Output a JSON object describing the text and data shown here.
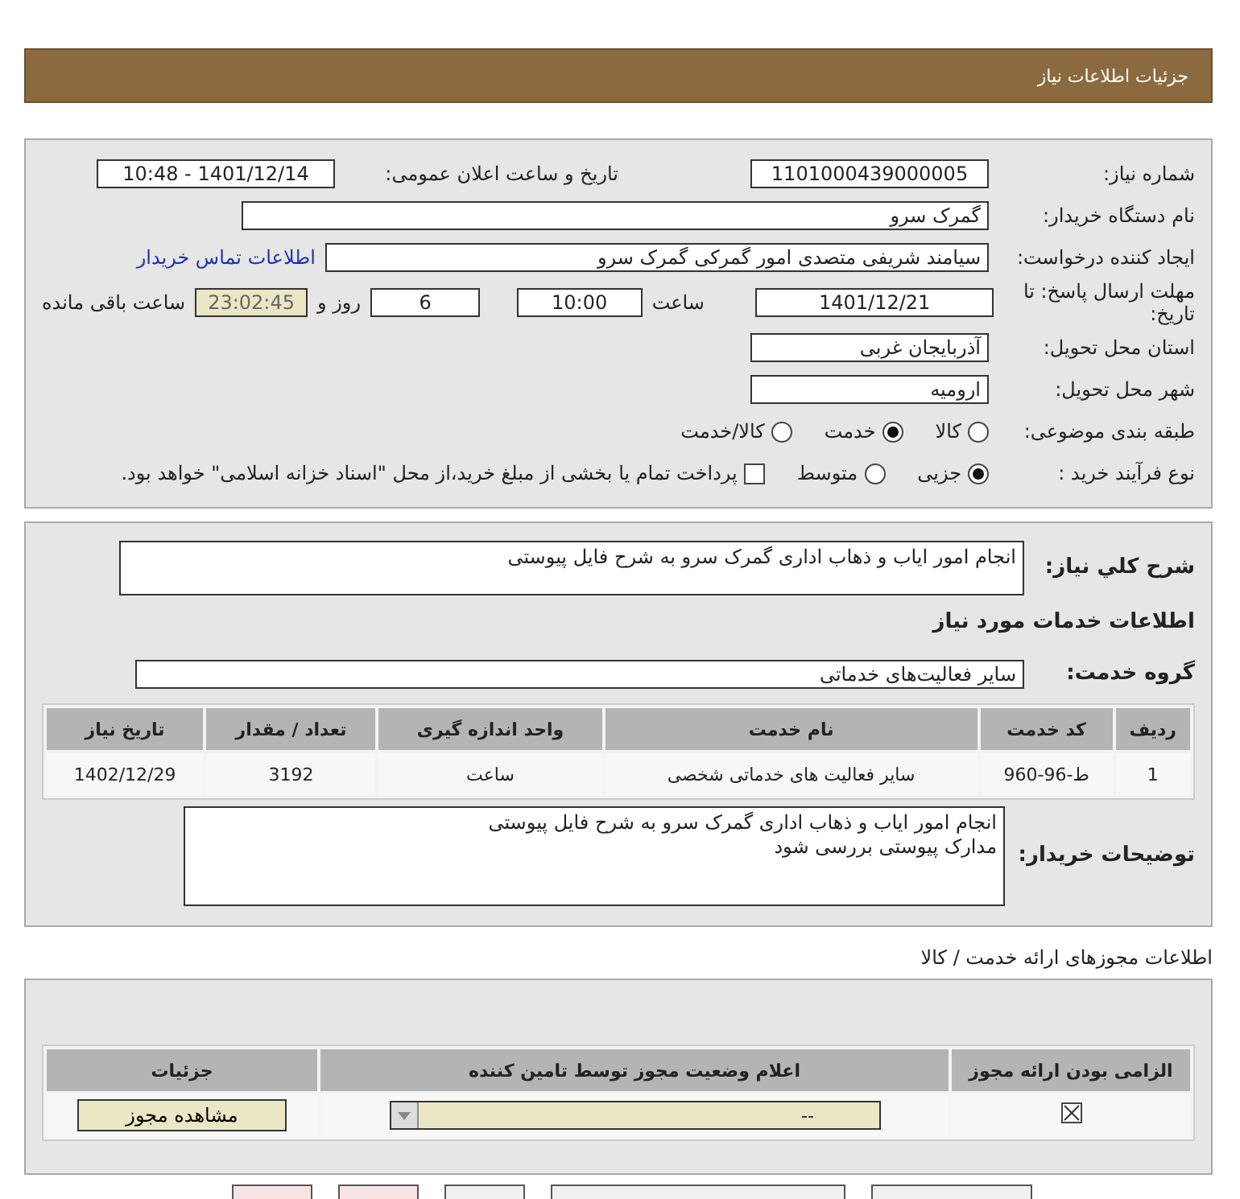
{
  "header": {
    "title": "جزئیات اطلاعات نیاز"
  },
  "details": {
    "need_number": {
      "label": "شماره نیاز:",
      "value": "1101000439000005"
    },
    "announce": {
      "label": "تاریخ و ساعت اعلان عمومی:",
      "value": "1401/12/14 - 10:48"
    },
    "buyer": {
      "label": "نام دستگاه خریدار:",
      "value": "گمرک سرو"
    },
    "creator": {
      "label": "ایجاد کننده درخواست:",
      "value": "سیامند شریفی متصدی امور گمرکی گمرک سرو",
      "link": "اطلاعات تماس خریدار"
    },
    "deadline": {
      "label": "مهلت ارسال پاسخ: تا تاریخ:",
      "date": "1401/12/21",
      "time_label": "ساعت",
      "time": "10:00",
      "days": "6",
      "days_label": "روز و",
      "remaining": "23:02:45",
      "remaining_label": "ساعت باقی مانده"
    },
    "province": {
      "label": "استان محل تحویل:",
      "value": "آذربایجان غربی"
    },
    "city": {
      "label": "شهر محل تحویل:",
      "value": "ارومیه"
    },
    "category": {
      "label": "طبقه بندی موضوعی:",
      "options": [
        {
          "label": "کالا",
          "selected": false
        },
        {
          "label": "خدمت",
          "selected": true
        },
        {
          "label": "کالا/خدمت",
          "selected": false
        }
      ]
    },
    "process": {
      "label": "نوع فرآیند خرید :",
      "options": [
        {
          "label": "جزیی",
          "selected": true
        },
        {
          "label": "متوسط",
          "selected": false
        }
      ],
      "payment": {
        "label": "پرداخت تمام یا بخشی از مبلغ خرید،از محل \"اسناد خزانه اسلامی\" خواهد بود.",
        "checked": false
      }
    }
  },
  "services": {
    "summary": {
      "label": "شرح کلي نياز:",
      "value": "انجام امور ایاب و ذهاب اداری گمرک سرو به شرح فایل پیوستی"
    },
    "heading": "اطلاعات خدمات مورد نیاز",
    "group": {
      "label": "گروه خدمت:",
      "value": "سایر فعالیت‌های خدماتی"
    },
    "table": {
      "columns": [
        "ردیف",
        "کد خدمت",
        "نام خدمت",
        "واحد اندازه گیری",
        "تعداد / مقدار",
        "تاریخ نیاز"
      ],
      "rows": [
        [
          "1",
          "ط-96-960",
          "سایر فعالیت های خدماتی شخصی",
          "ساعت",
          "3192",
          "1402/12/29"
        ]
      ]
    },
    "notes": {
      "label": "توضیحات خریدار:",
      "lines": [
        "انجام امور ایاب و ذهاب اداری گمرک سرو به شرح فایل پیوستی",
        "مدارک پیوستی بررسی شود"
      ]
    }
  },
  "permits": {
    "title": "اطلاعات مجوزهای ارائه خدمت / کالا",
    "columns": [
      "الزامی بودن ارائه مجوز",
      "اعلام وضعیت مجوز توسط تامین کننده",
      "جزئیات"
    ],
    "rows": [
      {
        "required": true,
        "status": "--",
        "button": "مشاهده مجوز"
      }
    ]
  }
}
